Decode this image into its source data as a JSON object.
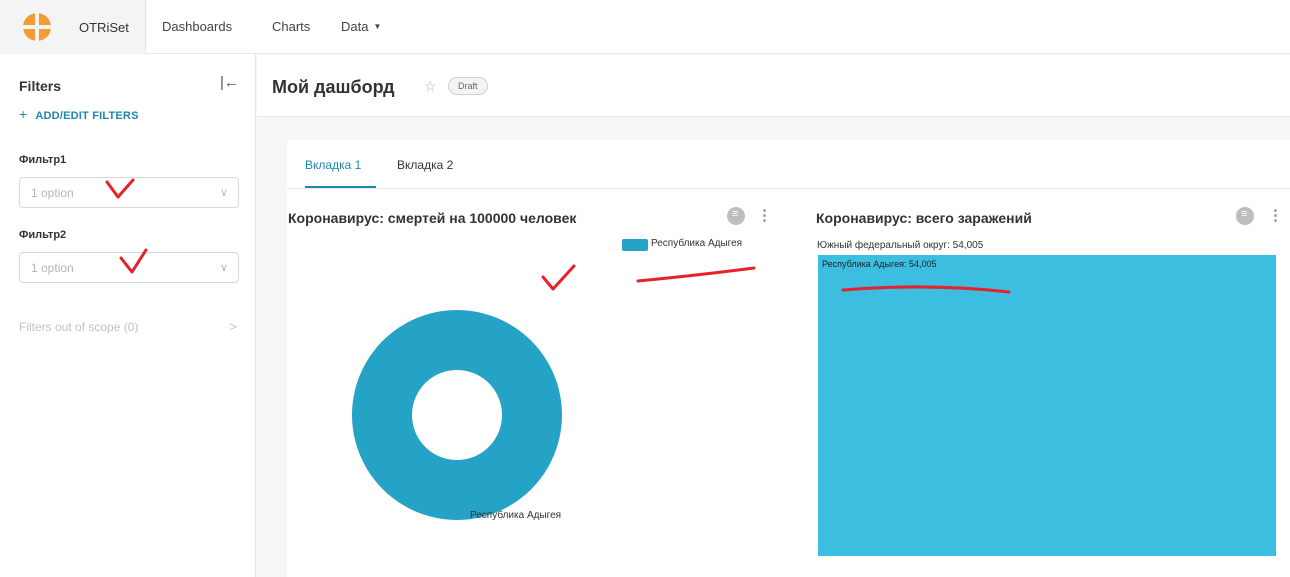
{
  "app": {
    "brand": "OTRiSet"
  },
  "nav": {
    "dashboards": "Dashboards",
    "charts": "Charts",
    "data": "Data"
  },
  "sidebar": {
    "title": "Filters",
    "add_edit": "ADD/EDIT FILTERS",
    "filters": [
      {
        "label": "Фильтр1",
        "placeholder": "1 option"
      },
      {
        "label": "Фильтр2",
        "placeholder": "1 option"
      }
    ],
    "out_of_scope": "Filters out of scope (0)"
  },
  "dashboard": {
    "title": "Мой дашборд",
    "status": "Draft"
  },
  "tabs": [
    {
      "label": "Вкладка 1",
      "active": true
    },
    {
      "label": "Вкладка 2",
      "active": false
    }
  ],
  "charts": [
    {
      "title": "Коронавирус: смертей на 100000 человек",
      "legend": "Республика Адыгея",
      "slice_label": "Республика Адыгея"
    },
    {
      "title": "Коронавирус: всего заражений",
      "root_label": "Южный федеральный округ: 54,005",
      "leaf_label": "Республика Адыгея: 54,005"
    }
  ],
  "chart_data": [
    {
      "type": "pie",
      "title": "Коронавирус: смертей на 100000 человек",
      "categories": [
        "Республика Адыгея"
      ],
      "values": [
        1
      ],
      "legend": "top-right",
      "color": "#24a3c7"
    },
    {
      "type": "heatmap",
      "title": "Коронавирус: всего заражений",
      "categories": [
        "Республика Адыгея"
      ],
      "values": [
        54005
      ],
      "parent": "Южный федеральный округ",
      "parent_value": 54005,
      "color": "#3bbedf"
    }
  ],
  "colors": {
    "accent": "#1e87b0",
    "annotation": "#e8202a"
  }
}
